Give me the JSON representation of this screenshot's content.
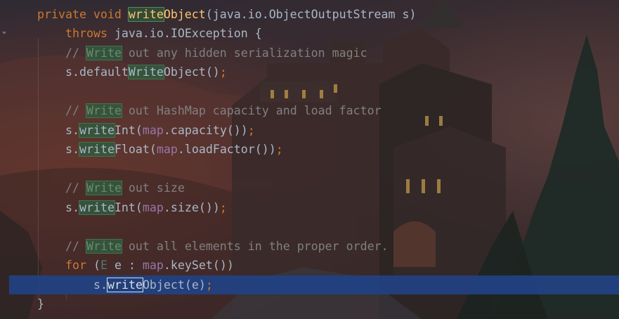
{
  "editor": {
    "lines": [
      [
        {
          "t": "private void ",
          "c": "kw"
        },
        {
          "t": "write",
          "c": "fn hl first"
        },
        {
          "t": "Object",
          "c": "fn"
        },
        {
          "t": "(java.io.ObjectOutputStream s)",
          "c": ""
        }
      ],
      [
        {
          "t": "throws ",
          "c": "kw"
        },
        {
          "t": "java.io.IOException {",
          "c": ""
        }
      ],
      [
        {
          "t": "// ",
          "c": "cm"
        },
        {
          "t": "Write",
          "c": "cm hl"
        },
        {
          "t": " out any hidden serialization magic",
          "c": "cm"
        }
      ],
      [
        {
          "t": "s.default",
          "c": ""
        },
        {
          "t": "Write",
          "c": "hl"
        },
        {
          "t": "Object()",
          "c": ""
        },
        {
          "t": ";",
          "c": "kw"
        }
      ],
      [],
      [
        {
          "t": "// ",
          "c": "cm"
        },
        {
          "t": "Write",
          "c": "cm hl"
        },
        {
          "t": " out HashMap capacity and load factor",
          "c": "cm"
        }
      ],
      [
        {
          "t": "s.",
          "c": ""
        },
        {
          "t": "write",
          "c": "hl"
        },
        {
          "t": "Int(",
          "c": ""
        },
        {
          "t": "map",
          "c": "fld"
        },
        {
          "t": ".capacity())",
          "c": ""
        },
        {
          "t": ";",
          "c": "kw"
        }
      ],
      [
        {
          "t": "s.",
          "c": ""
        },
        {
          "t": "write",
          "c": "hl"
        },
        {
          "t": "Float(",
          "c": ""
        },
        {
          "t": "map",
          "c": "fld"
        },
        {
          "t": ".loadFactor())",
          "c": ""
        },
        {
          "t": ";",
          "c": "kw"
        }
      ],
      [],
      [
        {
          "t": "// ",
          "c": "cm"
        },
        {
          "t": "Write",
          "c": "cm hl"
        },
        {
          "t": " out size",
          "c": "cm"
        }
      ],
      [
        {
          "t": "s.",
          "c": ""
        },
        {
          "t": "write",
          "c": "hl"
        },
        {
          "t": "Int(",
          "c": ""
        },
        {
          "t": "map",
          "c": "fld"
        },
        {
          "t": ".size())",
          "c": ""
        },
        {
          "t": ";",
          "c": "kw"
        }
      ],
      [],
      [
        {
          "t": "// ",
          "c": "cm"
        },
        {
          "t": "Write",
          "c": "cm hl"
        },
        {
          "t": " out all elements in the proper order.",
          "c": "cm"
        }
      ],
      [
        {
          "t": "for ",
          "c": "kw"
        },
        {
          "t": "(",
          "c": ""
        },
        {
          "t": "E",
          "c": "tp"
        },
        {
          "t": " e : ",
          "c": ""
        },
        {
          "t": "map",
          "c": "fld"
        },
        {
          "t": ".keySet())",
          "c": ""
        }
      ],
      [
        {
          "t": "s.",
          "c": ""
        },
        {
          "t": "write",
          "c": "hl cur"
        },
        {
          "t": "Object(e)",
          "c": ""
        },
        {
          "t": ";",
          "c": "kw"
        }
      ],
      [
        {
          "t": "}",
          "c": ""
        }
      ]
    ]
  },
  "colors": {
    "keyword": "#cc7832",
    "comment": "#808080",
    "method_declaration": "#ffc66d",
    "field": "#9876aa",
    "type_parameter": "#507874",
    "default_text": "#a9b7c6",
    "current_line": "#214283",
    "usage_highlight": "#32593d"
  },
  "icons": {
    "fold_marker": "fold-arrow-icon"
  }
}
